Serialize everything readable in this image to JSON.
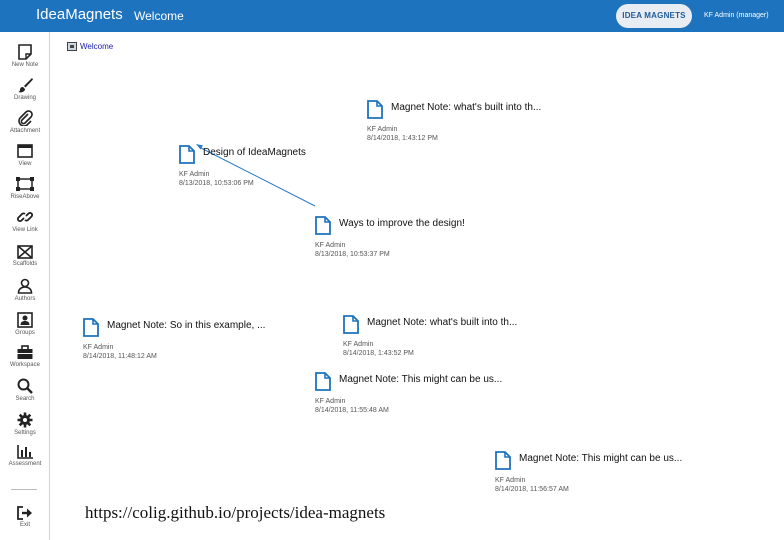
{
  "header": {
    "app_title": "IdeaMagnets",
    "page_tab": "Welcome",
    "mode_button": "IDEA MAGNETS",
    "user": "KF Admin (manager)"
  },
  "sidebar": {
    "items": [
      {
        "label": "New Note",
        "icon": "new-note-icon"
      },
      {
        "label": "Drawing",
        "icon": "brush-icon"
      },
      {
        "label": "Attachment",
        "icon": "paperclip-icon"
      },
      {
        "label": "View",
        "icon": "window-icon"
      },
      {
        "label": "RiseAbove",
        "icon": "riseabove-icon"
      },
      {
        "label": "View Link",
        "icon": "link-icon"
      },
      {
        "label": "Scaffolds",
        "icon": "scaffold-icon"
      },
      {
        "label": "Authors",
        "icon": "person-icon"
      },
      {
        "label": "Groups",
        "icon": "group-icon"
      },
      {
        "label": "Workspace",
        "icon": "briefcase-icon"
      },
      {
        "label": "Search",
        "icon": "search-icon"
      },
      {
        "label": "Settings",
        "icon": "gear-icon"
      },
      {
        "label": "Assessment",
        "icon": "bar-chart-icon"
      }
    ],
    "exit_label": "Exit"
  },
  "breadcrumb": {
    "label": "Welcome"
  },
  "notes": [
    {
      "title": "Magnet Note: what's built into th...",
      "author": "KF Admin",
      "date": "8/14/2018, 1:43:12 PM"
    },
    {
      "title": "Design of IdeaMagnets",
      "author": "KF Admin",
      "date": "8/13/2018, 10:53:06 PM"
    },
    {
      "title": "Ways to improve the design!",
      "author": "KF Admin",
      "date": "8/13/2018, 10:53:37 PM"
    },
    {
      "title": "Magnet Note: So in this example, ...",
      "author": "KF Admin",
      "date": "8/14/2018, 11:48:12 AM"
    },
    {
      "title": "Magnet Note: what's built into th...",
      "author": "KF Admin",
      "date": "8/14/2018, 1:43:52 PM"
    },
    {
      "title": "Magnet Note: This might can be us...",
      "author": "KF Admin",
      "date": "8/14/2018, 11:55:48 AM"
    },
    {
      "title": "Magnet Note: This might can be us...",
      "author": "KF Admin",
      "date": "8/14/2018, 11:56:57 AM"
    }
  ],
  "caption": "https://colig.github.io/projects/idea-magnets",
  "colors": {
    "header": "#1e73be",
    "icon": "#1e73be",
    "link": "#1a1aa6"
  }
}
